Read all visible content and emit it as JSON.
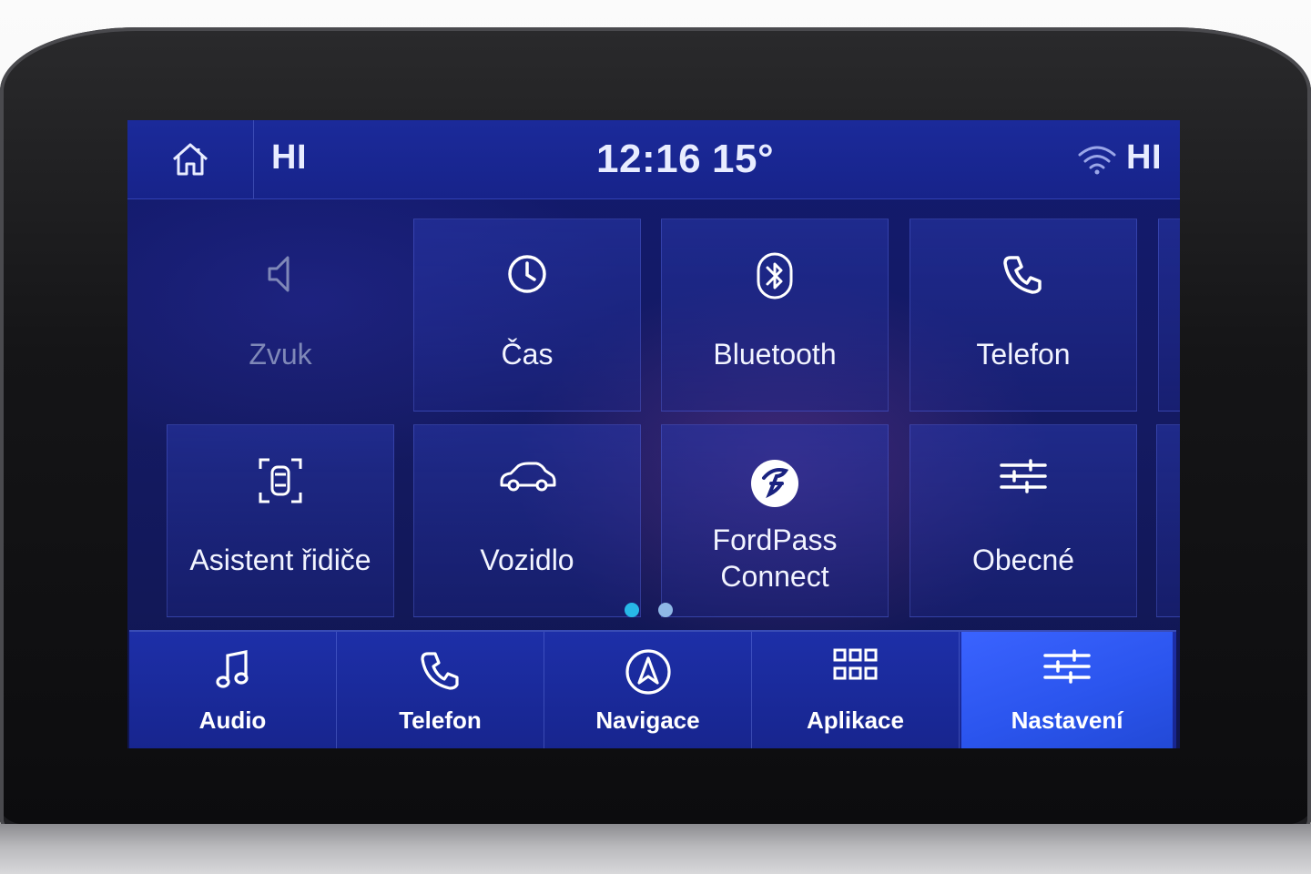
{
  "status_bar": {
    "left_label": "HI",
    "time": "12:16",
    "temperature": "15°",
    "right_label": "HI",
    "icons": {
      "home": "home-icon",
      "wifi": "wifi-icon"
    }
  },
  "tiles": [
    {
      "label": "Zvuk",
      "icon": "speaker-icon",
      "enabled": false
    },
    {
      "label": "Čas",
      "icon": "clock-icon",
      "enabled": true
    },
    {
      "label": "Bluetooth",
      "icon": "bluetooth-icon",
      "enabled": true
    },
    {
      "label": "Telefon",
      "icon": "phone-icon",
      "enabled": true
    },
    {
      "label": "Asistent řidiče",
      "icon": "driver-assist-icon",
      "enabled": true
    },
    {
      "label": "Vozidlo",
      "icon": "car-icon",
      "enabled": true
    },
    {
      "label_line1": "FordPass",
      "label_line2": "Connect",
      "icon": "fordpass-icon",
      "enabled": true
    },
    {
      "label": "Obecné",
      "icon": "sliders-icon",
      "enabled": true
    }
  ],
  "pagination": {
    "total_pages": 2,
    "current_page": 1,
    "active_color": "#27b8e8",
    "inactive_color": "#8fb8e6"
  },
  "bottom_nav": [
    {
      "label": "Audio",
      "icon": "music-note-icon",
      "active": false
    },
    {
      "label": "Telefon",
      "icon": "phone-icon",
      "active": false
    },
    {
      "label": "Navigace",
      "icon": "navigation-icon",
      "active": false
    },
    {
      "label": "Aplikace",
      "icon": "apps-grid-icon",
      "active": false
    },
    {
      "label": "Nastavení",
      "icon": "settings-sliders-icon",
      "active": true
    }
  ],
  "colors": {
    "screen_bg": "#141a63",
    "status_bar_bg": "#1b2a9a",
    "nav_bg": "#1d2fa8",
    "nav_active_bg": "#2b55ee",
    "text": "#f2f4ff"
  }
}
